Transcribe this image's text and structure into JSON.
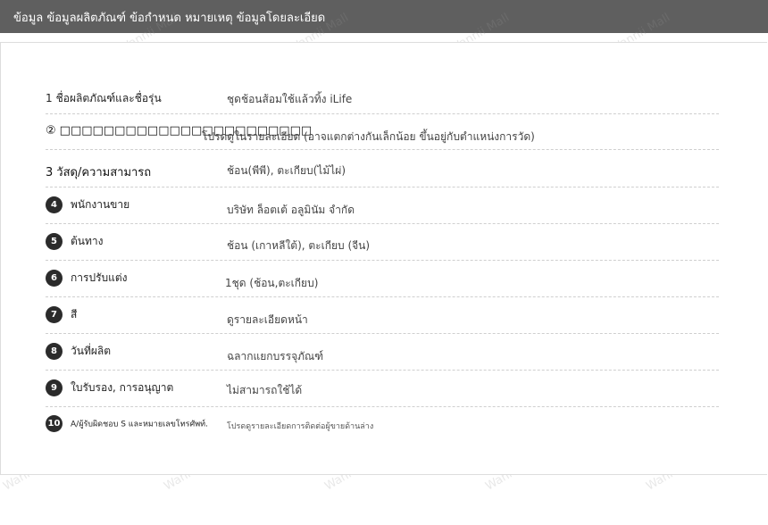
{
  "header": {
    "title": "ข้อมูล ข้อมูลผลิตภัณฑ์ ข้อกำหนด หมายเหตุ ข้อมูลโดยละเอียด"
  },
  "watermark": "Wannii Mall",
  "specs": [
    {
      "number": "1",
      "label": "ชื่อผลิตภัณฑ์และชื่อรุ่น",
      "value": "ชุดช้อนส้อมใช้แล้วทิ้ง iLife"
    },
    {
      "number": "②",
      "label": "□□□□□□□□□□□□□□□□□□□□□□□",
      "value": "โปรดดูในรายละเอียด (อาจแตกต่างกันเล็กน้อย ขึ้นอยู่กับตำแหน่งการวัด)"
    },
    {
      "number": "3",
      "label": "วัสดุ/ความสามารถ",
      "value": "ช้อน(พีพี), ตะเกียบ(ไม้ไผ่)"
    },
    {
      "number": "4",
      "label": "พนักงานขาย",
      "value": "บริษัท ล็อตเต้ อลูมินัม จำกัด"
    },
    {
      "number": "5",
      "label": "ต้นทาง",
      "value": "ช้อน (เกาหลีใต้), ตะเกียบ (จีน)"
    },
    {
      "number": "6",
      "label": "การปรับแต่ง",
      "value": "1ชุด (ช้อน,ตะเกียบ)"
    },
    {
      "number": "7",
      "label": "สี",
      "value": "ดูรายละเอียดหน้า"
    },
    {
      "number": "8",
      "label": "วันที่ผลิต",
      "value": "ฉลากแยกบรรจุภัณฑ์"
    },
    {
      "number": "9",
      "label": "ใบรับรอง, การอนุญาต",
      "value": "ไม่สามารถใช้ได้"
    },
    {
      "number": "10",
      "label": "A/ผู้รับผิดชอบ S และหมายเลขโทรศัพท์.",
      "value": "โปรดดูรายละเอียดการติดต่อผู้ขายด้านล่าง"
    }
  ]
}
